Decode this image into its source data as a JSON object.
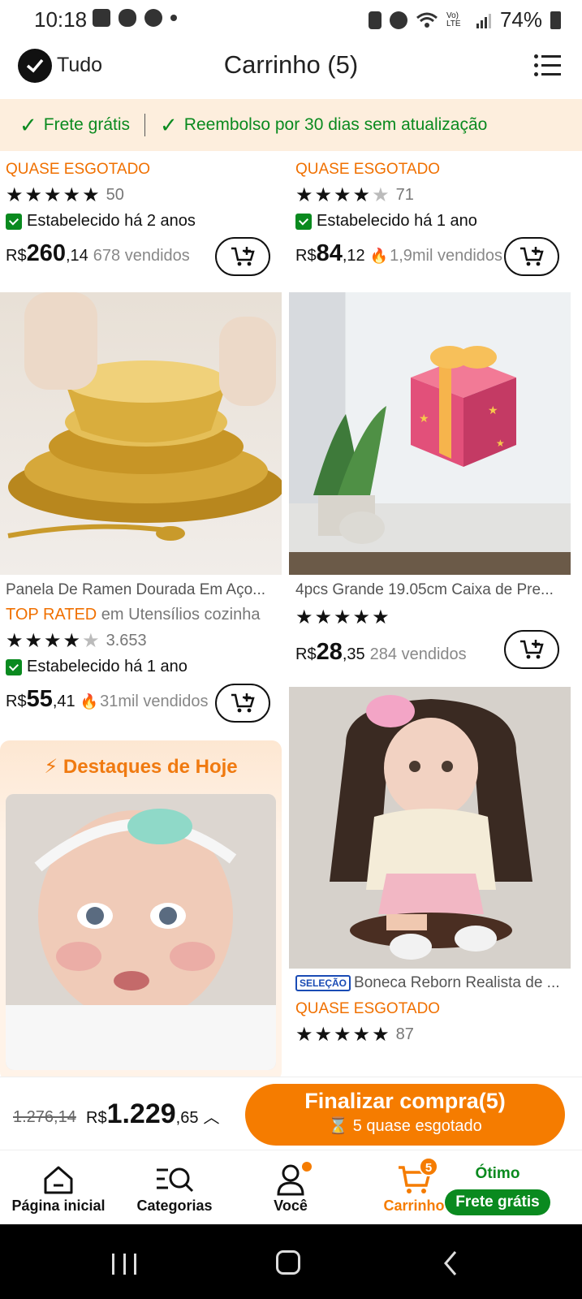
{
  "status_bar": {
    "time": "10:18",
    "battery": "74%",
    "net": "Vo) LTE"
  },
  "header": {
    "select_all_label": "Tudo",
    "title": "Carrinho (5)"
  },
  "banner": {
    "item1": "Frete grátis",
    "item2": "Reembolso por 30 dias sem atualização"
  },
  "products": [
    {
      "status": "QUASE ESGOTADO",
      "rating": 5.0,
      "rating_count": "50",
      "established": "Estabelecido há 2 anos",
      "currency": "R$",
      "price_int": "260",
      "price_dec": ",14",
      "sold": "678 vendidos"
    },
    {
      "status": "QUASE ESGOTADO",
      "rating": 4.5,
      "rating_count": "71",
      "established": "Estabelecido há 1 ano",
      "currency": "R$",
      "price_int": "84",
      "price_dec": ",12",
      "sold": "1,9mil vendidos"
    },
    {
      "title": "Panela De Ramen Dourada Em Aço...",
      "tag_highlight": "TOP RATED",
      "tag_rest": " em Utensílios cozinha",
      "rating": 4.5,
      "rating_count": "3.653",
      "established": "Estabelecido há 1 ano",
      "currency": "R$",
      "price_int": "55",
      "price_dec": ",41",
      "sold": "31mil vendidos"
    },
    {
      "title": "4pcs Grande 19.05cm Caixa de Pre...",
      "rating": 5.0,
      "currency": "R$",
      "price_int": "28",
      "price_dec": ",35",
      "sold": "284 vendidos"
    },
    {
      "badge": "SELEÇÃO",
      "title": "Boneca Reborn Realista de ...",
      "status": "QUASE ESGOTADO",
      "rating": 5.0,
      "rating_count": "87"
    }
  ],
  "highlights": {
    "title": "Destaques de Hoje"
  },
  "summary": {
    "old_price": "1.276,14",
    "currency": "R$",
    "total_int": "1.229",
    "total_dec": ",65"
  },
  "checkout": {
    "label": "Finalizar compra(5)",
    "sub": "5 quase esgotado"
  },
  "nav": {
    "home": "Página inicial",
    "categories": "Categorias",
    "you": "Você",
    "cart": "Carrinho",
    "cart_badge": "5",
    "promo_top": "Ótimo",
    "promo_pill": "Frete grátis"
  },
  "colors": {
    "accent": "#f57c00",
    "green": "#0a8a1f",
    "banner_bg": "#fdeedd"
  }
}
